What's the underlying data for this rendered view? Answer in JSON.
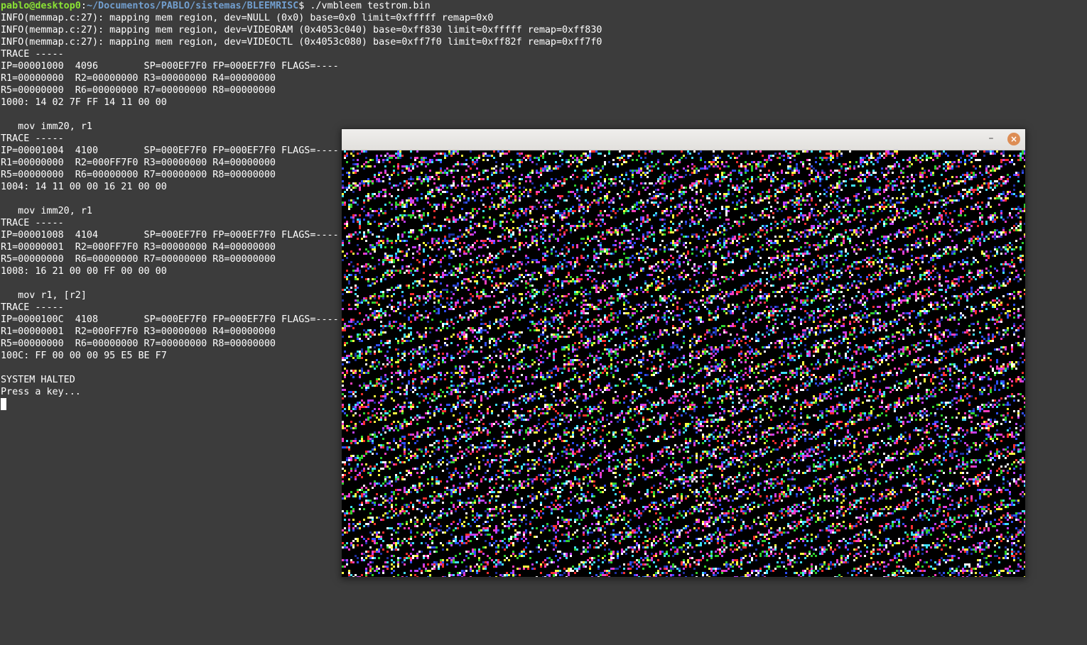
{
  "terminal": {
    "prompt": {
      "user_host": "pablo@desktop0",
      "separator": ":",
      "path": "~/Documentos/PABLO/sistemas/BLEEMRISC",
      "symbol": "$ ",
      "command": "./vmbleem testrom.bin"
    },
    "lines": [
      "INFO(memmap.c:27): mapping mem region, dev=NULL (0x0) base=0x0 limit=0xfffff remap=0x0",
      "INFO(memmap.c:27): mapping mem region, dev=VIDEORAM (0x4053c040) base=0xff830 limit=0xfffff remap=0xff830",
      "INFO(memmap.c:27): mapping mem region, dev=VIDEOCTL (0x4053c080) base=0xff7f0 limit=0xff82f remap=0xff7f0",
      "TRACE -----",
      "IP=00001000  4096        SP=000EF7F0 FP=000EF7F0 FLAGS=----",
      "R1=00000000  R2=00000000 R3=00000000 R4=00000000",
      "R5=00000000  R6=00000000 R7=00000000 R8=00000000",
      "1000: 14 02 7F FF 14 11 00 00",
      "",
      "   mov imm20, r1",
      "TRACE -----",
      "IP=00001004  4100        SP=000EF7F0 FP=000EF7F0 FLAGS=----",
      "R1=00000000  R2=000FF7F0 R3=00000000 R4=00000000",
      "R5=00000000  R6=00000000 R7=00000000 R8=00000000",
      "1004: 14 11 00 00 16 21 00 00",
      "",
      "   mov imm20, r1",
      "TRACE -----",
      "IP=00001008  4104        SP=000EF7F0 FP=000EF7F0 FLAGS=----",
      "R1=00000001  R2=000FF7F0 R3=00000000 R4=00000000",
      "R5=00000000  R6=00000000 R7=00000000 R8=00000000",
      "1008: 16 21 00 00 FF 00 00 00",
      "",
      "   mov r1, [r2]",
      "TRACE -----",
      "IP=0000100C  4108        SP=000EF7F0 FP=000EF7F0 FLAGS=----",
      "R1=00000001  R2=000FF7F0 R3=00000000 R4=00000000",
      "R5=00000000  R6=00000000 R7=00000000 R8=00000000",
      "100C: FF 00 00 00 95 E5 BE F7",
      "",
      "SYSTEM HALTED",
      "Press a key..."
    ]
  },
  "vm_window": {
    "minimize_label": "–",
    "close_label": "×",
    "pattern_colors": [
      "#ff3030",
      "#30d030",
      "#3050ff",
      "#ffffff",
      "#ffff40",
      "#40e0ff",
      "#c040ff",
      "#ff40c0",
      "#2030a0"
    ]
  }
}
